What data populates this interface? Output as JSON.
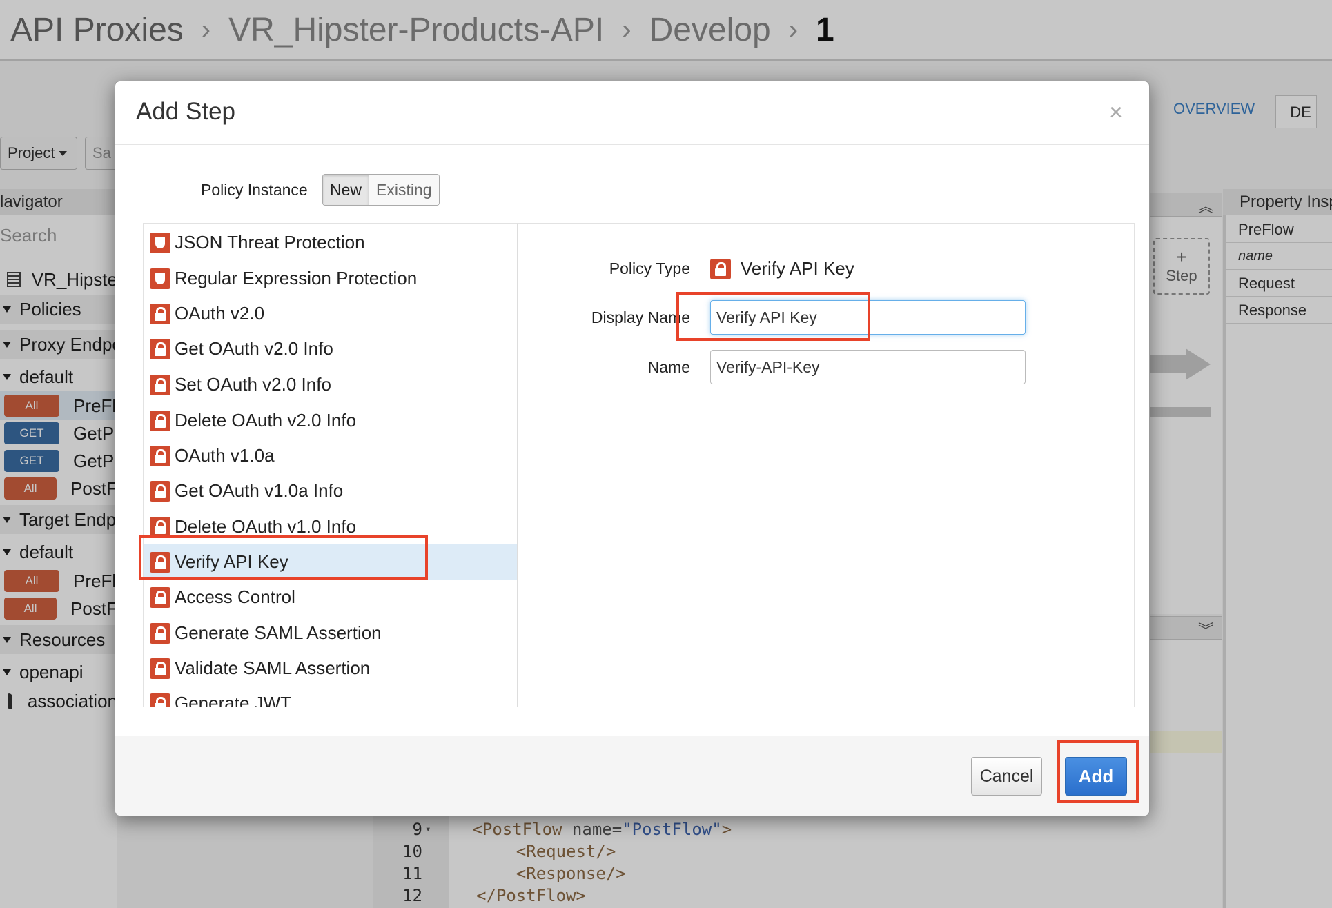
{
  "breadcrumb": {
    "items": [
      "API Proxies",
      "VR_Hipster-Products-API",
      "Develop"
    ],
    "current": "1",
    "separator": "›"
  },
  "tabs": {
    "overview": "OVERVIEW",
    "develop": "DE"
  },
  "toolbar": {
    "project": "Project",
    "save": "Sa"
  },
  "navigator": {
    "title": "lavigator",
    "search_placeholder": "Search",
    "proxy_name": "VR_Hipste",
    "policies": "Policies",
    "proxy_endpoints": "Proxy Endpoi",
    "proxy_default": "default",
    "proxy_flows": [
      {
        "badge": "All",
        "label": "PreFl"
      },
      {
        "badge": "GET",
        "label": "GetP"
      },
      {
        "badge": "GET",
        "label": "GetP"
      },
      {
        "badge": "All",
        "label": "PostF"
      }
    ],
    "target_endpoints": "Target Endpo",
    "target_default": "default",
    "target_flows": [
      {
        "badge": "All",
        "label": "PreFl"
      },
      {
        "badge": "All",
        "label": "PostF"
      }
    ],
    "resources": "Resources",
    "openapi": "openapi",
    "association": "association"
  },
  "canvas": {
    "step_plus": "+",
    "step_label": "Step"
  },
  "property_inspector": {
    "title": "Property Insp",
    "rows": [
      "PreFlow",
      "name",
      "Request",
      "Response"
    ]
  },
  "code": {
    "lines": [
      {
        "num": "9",
        "fold": "▾",
        "indent": "",
        "tag_open": "<PostFlow",
        "attr": " name=",
        "val": "\"PostFlow\"",
        "tag_close": ">"
      },
      {
        "num": "10",
        "fold": "",
        "indent": "    ",
        "tag_open": "<Request/>",
        "attr": "",
        "val": "",
        "tag_close": ""
      },
      {
        "num": "11",
        "fold": "",
        "indent": "    ",
        "tag_open": "<Response/>",
        "attr": "",
        "val": "",
        "tag_close": ""
      },
      {
        "num": "12",
        "fold": "",
        "indent": "",
        "tag_open": "</PostFlow>",
        "attr": "",
        "val": "",
        "tag_close": ""
      }
    ]
  },
  "dialog": {
    "title": "Add Step",
    "close": "×",
    "policy_instance_label": "Policy Instance",
    "segment": {
      "new": "New",
      "existing": "Existing"
    },
    "policies": [
      {
        "label": "JSON Threat Protection",
        "icon": "shield"
      },
      {
        "label": "Regular Expression Protection",
        "icon": "shield"
      },
      {
        "label": "OAuth v2.0",
        "icon": "lock"
      },
      {
        "label": "Get OAuth v2.0 Info",
        "icon": "lock"
      },
      {
        "label": "Set OAuth v2.0 Info",
        "icon": "lock"
      },
      {
        "label": "Delete OAuth v2.0 Info",
        "icon": "lock"
      },
      {
        "label": "OAuth v1.0a",
        "icon": "lock"
      },
      {
        "label": "Get OAuth v1.0a Info",
        "icon": "lock"
      },
      {
        "label": "Delete OAuth v1.0 Info",
        "icon": "lock"
      },
      {
        "label": "Verify API Key",
        "icon": "lock",
        "selected": true
      },
      {
        "label": "Access Control",
        "icon": "lock"
      },
      {
        "label": "Generate SAML Assertion",
        "icon": "lock"
      },
      {
        "label": "Validate SAML Assertion",
        "icon": "lock"
      },
      {
        "label": "Generate JWT",
        "icon": "lock"
      }
    ],
    "fields": {
      "policy_type_label": "Policy Type",
      "policy_type_value": "Verify API Key",
      "display_name_label": "Display Name",
      "display_name_value": "Verify API Key",
      "name_label": "Name",
      "name_value": "Verify-API-Key"
    },
    "buttons": {
      "cancel": "Cancel",
      "add": "Add"
    }
  },
  "colors": {
    "accent": "#2a6fcc",
    "policy_icon": "#d0492d",
    "highlight_box": "#e8432a",
    "selected_row": "#ddebf7"
  }
}
